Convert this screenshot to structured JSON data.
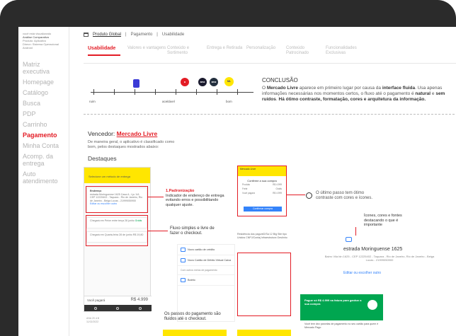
{
  "sidebar": {
    "user_lines": [
      "você está visualizando",
      "Análise Comparativa",
      "Produto: Aplicativo",
      "Direcn: Sistema Operacional Android"
    ],
    "items": [
      {
        "label": "Matriz executiva",
        "active": false
      },
      {
        "label": "Homepage",
        "active": false
      },
      {
        "label": "Catálogo",
        "active": false
      },
      {
        "label": "Busca",
        "active": false
      },
      {
        "label": "PDP",
        "active": false
      },
      {
        "label": "Carrinho",
        "active": false
      },
      {
        "label": "Pagamento",
        "active": true
      },
      {
        "label": "Minha Conta",
        "active": false
      },
      {
        "label": "Acomp. da entrega",
        "active": false
      },
      {
        "label": "Auto atendimento",
        "active": false
      }
    ]
  },
  "breadcrumb": {
    "items": [
      "Produto Global",
      "Pagamento",
      "Usabilidade"
    ]
  },
  "tabs": [
    {
      "label": "Usabilidade",
      "active": true
    },
    {
      "label": "Valores e vantagens",
      "active": false
    },
    {
      "label": "Conteúdo e Sortimento",
      "active": false
    },
    {
      "label": "Entrega e Retirada",
      "active": false
    },
    {
      "label": "Personalização",
      "active": false
    },
    {
      "label": "Conteúdo Patrocinado",
      "active": false
    },
    {
      "label": "Funcionalidades Exclusivas",
      "active": false
    }
  ],
  "scale": {
    "labels": [
      "ruim",
      "aceitável",
      "bom"
    ]
  },
  "brands": [
    {
      "name": "Brand B",
      "color": "#3b3bd6"
    },
    {
      "name": "Brand A",
      "color": "#e31c25"
    },
    {
      "name": "amazon",
      "color": "#1a1a2e"
    },
    {
      "name": "amazon",
      "color": "#232f3e"
    },
    {
      "name": "Mercado Livre",
      "color": "#ffe600"
    }
  ],
  "conclusao": {
    "title": "CONCLUSÃO",
    "p1": "O ",
    "p1_bold": "Mercado Livre",
    "p2": " aparece em primeiro lugar por causa da ",
    "p2_bold": "interface fluida",
    "p3": ". Usa apenas informações necessárias nos momentos certos, o fluxo até o pagamento é ",
    "p3_bold": "natural",
    "p4": " e ",
    "p4_bold": "sem ruídos",
    "p5": ". ",
    "p5_bold": "Há ótimo contraste, formatação, cores e arquitetura da informação."
  },
  "winner": {
    "prefix": "Vencedor:",
    "name": "Mercado Livre",
    "desc": "De maneira geral, o aplicativo é classificado como bom, pelos destaques mostrados abaixo:",
    "destaques": "Destaques"
  },
  "phone": {
    "header": "Selecione um método de entrega",
    "card1_title": "Endereço",
    "card1_text": "estrada Moringuense 1625 Casa A - Lju 1/A CEP 12225402 - Taquara - Rio de Janeiro, Rio de Janeiro - Beiga Lucas - 21999050900",
    "card1_link": "Editar ou escolher outro",
    "card2_text": "Chegará em Peixe entre terça 28 junho",
    "card2_price": "Grátis",
    "card3_text": "Chegará em Quarta-feira 28 de junho",
    "card3_price": "R$ 19,80",
    "footer_label": "Você pagará",
    "footer_price": "R$ 4.999",
    "meta1": "ANA 20 d ill",
    "meta2": "11/02/2022"
  },
  "annotations": {
    "a1_title": "1.Padronização",
    "a1_text": "Indicador de endereço de entrega evitando erros e possibilitando qualquer ajuste.",
    "fluxo": "Fluxo simples e livre de fazer o checkout.",
    "passos": "Os passos do pagamento são fluidos até o checkout.",
    "ultimo": "O último passo tem ótimo contraste com cores e ícones.",
    "icones": "Ícones, cores e fontes destacando o que é importante"
  },
  "popup": {
    "head": "Mercado Livre",
    "title": "Confirme a sua compra",
    "rows": [
      [
        "Produto",
        "R$ 4.999"
      ],
      [
        "Frete",
        "Grátis"
      ],
      [
        "Você pagará",
        "R$ 4.999"
      ]
    ],
    "button": "Confirmar compra"
  },
  "mid": {
    "text": "Residência dos paguntO/Sa 12 Big Site tipo Unidos CNPJ/Contaj Infraestrutura Gestinho"
  },
  "pay_panel": {
    "rows": [
      "Novo cartão de crédito",
      "Novo Cartão de Débito Virtual Caixa",
      "Boleto"
    ],
    "section": "Com outros meios de pagamento"
  },
  "address": {
    "title": "estrada Moringuense 1625",
    "sub": "Bairro Vila bin 1625 - CEP 12225402 - Taquara - Rio de Janeiro, Rio de Janeiro - Beiga Lucas - 21999050900",
    "link": "Editar ou escolher outro"
  },
  "green_card": {
    "text": "Pague só R$ 4.999 na fatura para ganhar a sua compra",
    "bottom": "Você tem dez parcelas de pagamento no seu cartão para quem é Mercado Pago"
  }
}
